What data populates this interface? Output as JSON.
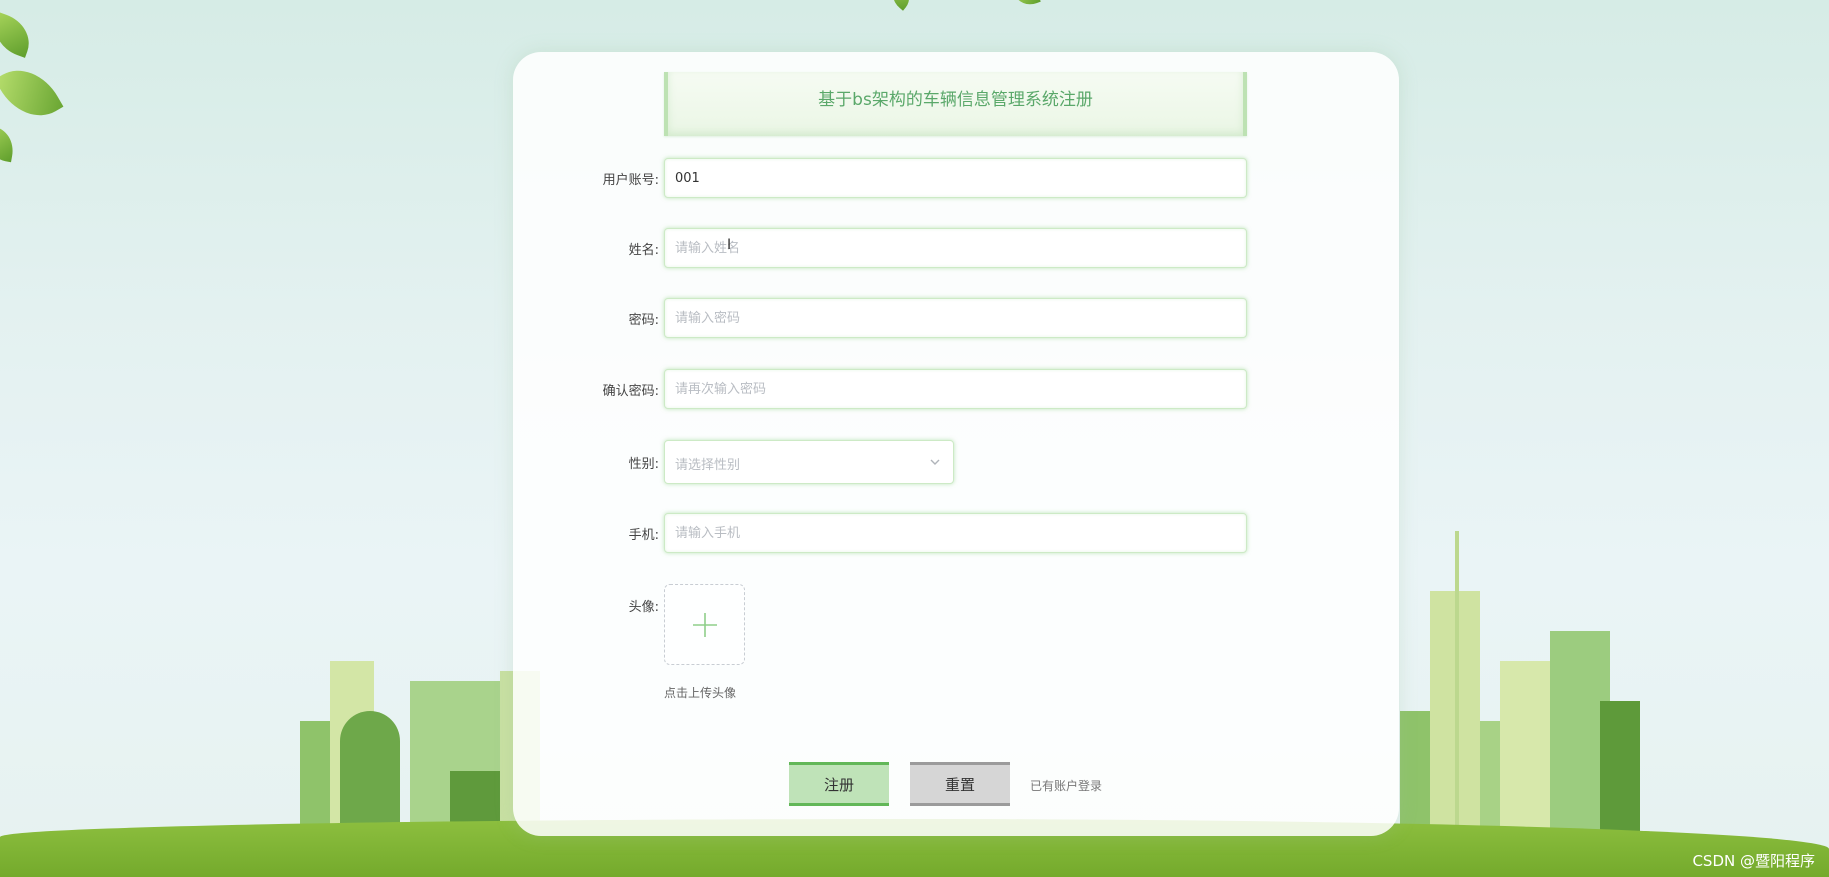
{
  "form": {
    "title": "基于bs架构的车辆信息管理系统注册",
    "fields": {
      "account": {
        "label": "用户账号:",
        "value": "001",
        "placeholder": ""
      },
      "name": {
        "label": "姓名:",
        "value": "",
        "placeholder": "请输入姓名"
      },
      "password": {
        "label": "密码:",
        "value": "",
        "placeholder": "请输入密码"
      },
      "confirm": {
        "label": "确认密码:",
        "value": "",
        "placeholder": "请再次输入密码"
      },
      "gender": {
        "label": "性别:",
        "placeholder": "请选择性别"
      },
      "phone": {
        "label": "手机:",
        "value": "",
        "placeholder": "请输入手机"
      },
      "avatar": {
        "label": "头像:",
        "hint": "点击上传头像"
      }
    },
    "buttons": {
      "register": "注册",
      "reset": "重置",
      "login_link": "已有账户登录"
    }
  },
  "watermark": "CSDN @暨阳程序",
  "colors": {
    "accent_green": "#5aa86a",
    "register_bg": "#bfe3b8",
    "reset_bg": "#d6d6d6",
    "ground": "#74aa2c"
  },
  "icons": {
    "select_arrow": "chevron-down-icon",
    "upload": "plus-icon",
    "text_cursor": "i-beam-cursor-icon"
  }
}
